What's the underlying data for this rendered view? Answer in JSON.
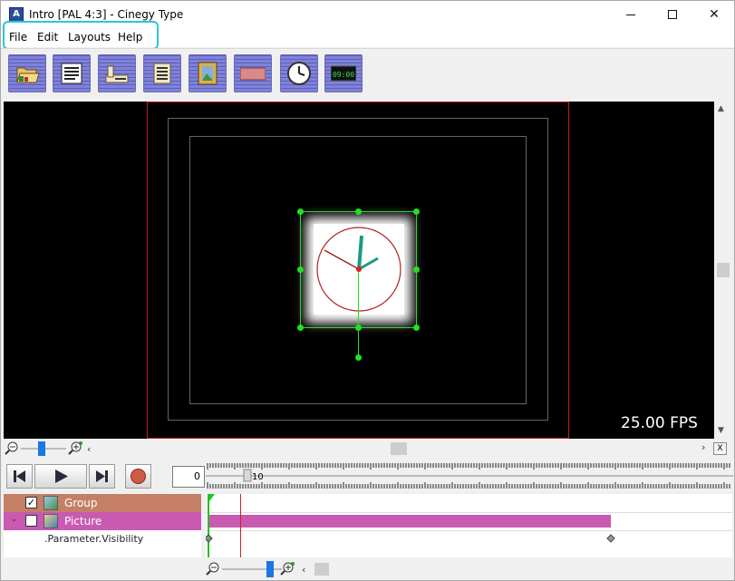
{
  "window": {
    "title": "Intro [PAL 4:3] - Cinegy Type",
    "icon_label": "A",
    "controls": {
      "minimize": "minimize-icon",
      "maximize": "maximize-icon",
      "close": "✕"
    }
  },
  "menu": {
    "items": [
      {
        "label": "File"
      },
      {
        "label": "Edit"
      },
      {
        "label": "Layouts"
      },
      {
        "label": "Help"
      }
    ]
  },
  "toolbar": {
    "buttons": [
      {
        "icon": "open-folder-icon"
      },
      {
        "icon": "text-document-icon"
      },
      {
        "icon": "crawl-text-icon"
      },
      {
        "icon": "roll-text-icon"
      },
      {
        "icon": "picture-frame-icon"
      },
      {
        "icon": "rectangle-shape-icon"
      },
      {
        "icon": "analog-clock-icon"
      },
      {
        "icon": "digital-clock-icon",
        "text": "09:00"
      }
    ]
  },
  "preview": {
    "fps": "25.00 FPS"
  },
  "timeline": {
    "frame_value": "0",
    "marker_label": "10",
    "tracks": [
      {
        "label": "Group",
        "checked": "✓"
      },
      {
        "label": "Picture",
        "checked": ""
      }
    ],
    "parameter": ".Parameter.Visibility",
    "close_label": "X"
  },
  "colors": {
    "group_row": "#c47f66",
    "picture_row": "#c85ab2",
    "selection_green": "#22e022",
    "accent_cyan": "#2ec4d6"
  }
}
